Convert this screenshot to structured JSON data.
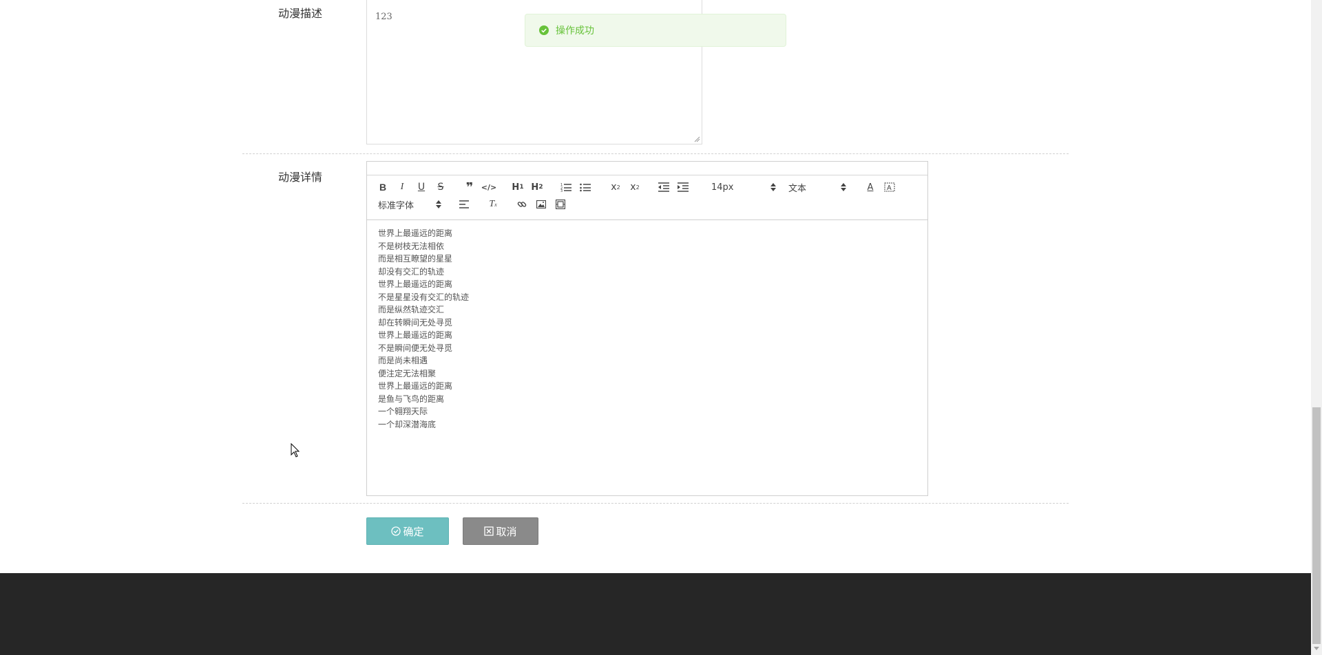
{
  "form": {
    "description_label": "动漫描述",
    "description_value": "123",
    "detail_label": "动漫详情"
  },
  "editor": {
    "font_size": "14px",
    "header_type": "文本",
    "font_family": "标准字体",
    "lines": [
      "世界上最遥远的距离",
      "不是树枝无法相依",
      "而是相互瞭望的星星",
      "却没有交汇的轨迹",
      "世界上最遥远的距离",
      "不是星星没有交汇的轨迹",
      "而是纵然轨迹交汇",
      "却在转瞬间无处寻觅",
      "世界上最遥远的距离",
      "不是瞬间便无处寻觅",
      "而是尚未相遇",
      "便注定无法相聚",
      "世界上最遥远的距离",
      "是鱼与飞鸟的距离",
      "一个翱翔天际",
      "一个却深潜海底"
    ]
  },
  "buttons": {
    "confirm_label": "确定",
    "cancel_label": "取消"
  },
  "toast": {
    "message": "操作成功",
    "color": "#67c23a"
  }
}
